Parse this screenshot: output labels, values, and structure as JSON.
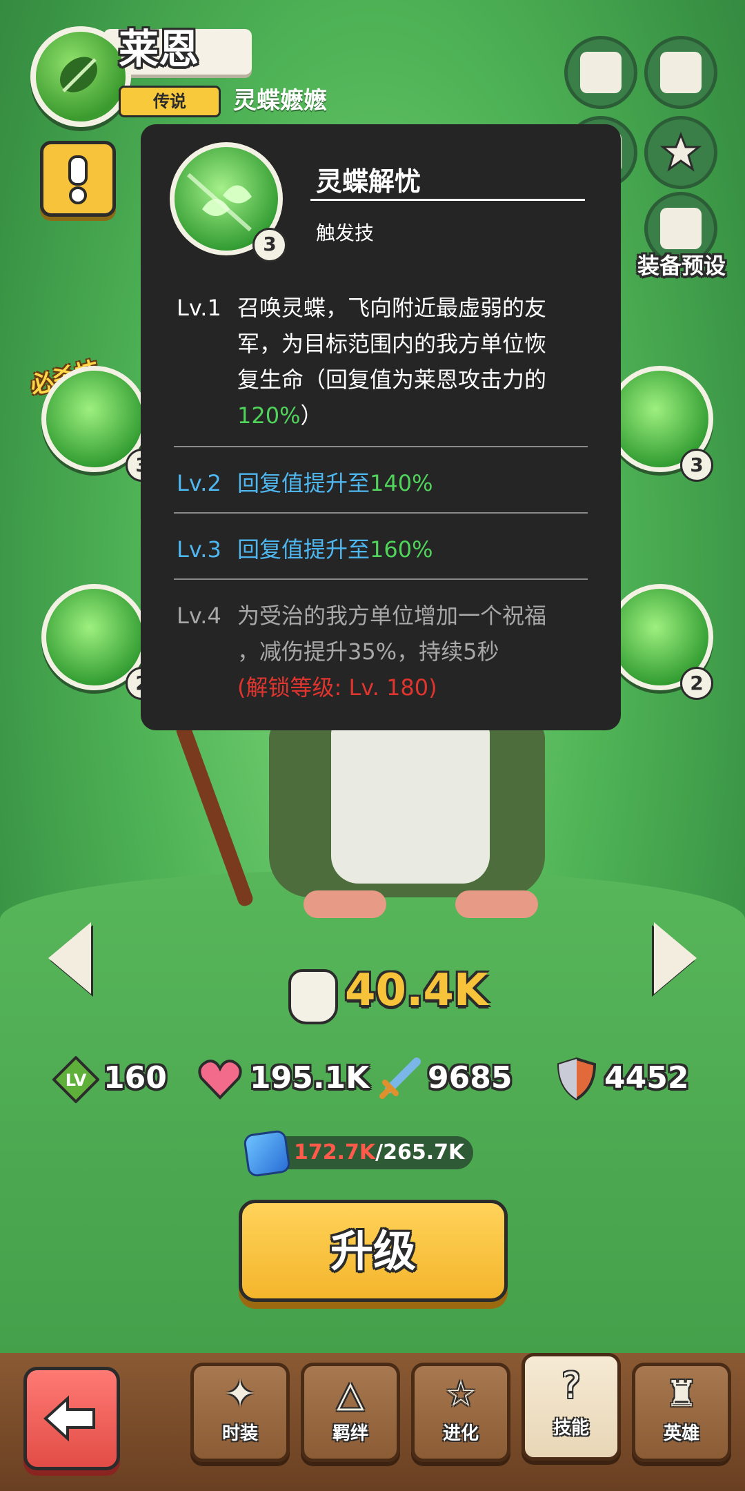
{
  "hero": {
    "name": "莱恩",
    "rarity": "传说",
    "title": "灵蝶嬷嬷"
  },
  "side_buttons": {
    "equipment_preset_label": "装备预设"
  },
  "skills": {
    "ultimate_label": "必杀技",
    "left_top_level": "3",
    "left_bottom_level": "2",
    "right_top_level": "3",
    "right_bottom_level": "2"
  },
  "tooltip": {
    "skill_name": "灵蝶解忧",
    "skill_type": "触发技",
    "skill_level": "3",
    "levels": [
      {
        "lv": "Lv.1",
        "desc_line1": "召唤灵蝶，飞向附近最虚弱的友",
        "desc_line2": "军，为目标范围内的我方单位恢",
        "desc_line3": "复生命（回复值为莱恩攻击力的",
        "desc_pct": "120%",
        "desc_tail": "）"
      },
      {
        "lv": "Lv.2",
        "desc": "回复值提升至",
        "pct": "140%"
      },
      {
        "lv": "Lv.3",
        "desc": "回复值提升至",
        "pct": "160%"
      },
      {
        "lv": "Lv.4",
        "desc_line1": "为受治的我方单位增加一个祝福",
        "desc_line2": "，减伤提升35%，持续5秒",
        "unlock": "(解锁等级: Lv. 180)"
      }
    ]
  },
  "power": "40.4K",
  "stats": {
    "level_icon_text": "LV",
    "level": "160",
    "hp": "195.1K",
    "attack": "9685",
    "defense": "4452"
  },
  "exp": {
    "current": "172.7K",
    "max": "/265.7K"
  },
  "upgrade_label": "升级",
  "bottom_tabs": [
    {
      "label": "时装",
      "icon": "costume-icon"
    },
    {
      "label": "羁绊",
      "icon": "bond-icon"
    },
    {
      "label": "进化",
      "icon": "evolve-star-icon"
    },
    {
      "label": "技能",
      "icon": "skill-icon"
    },
    {
      "label": "英雄",
      "icon": "hero-helmet-icon"
    }
  ],
  "colors": {
    "background_green": "#4fb356",
    "tooltip_bg": "#252525",
    "accent_yellow": "#f7c33a",
    "level_blue": "#4fb7f0",
    "value_green": "#4fd35a",
    "unlock_red": "#e0352f"
  }
}
